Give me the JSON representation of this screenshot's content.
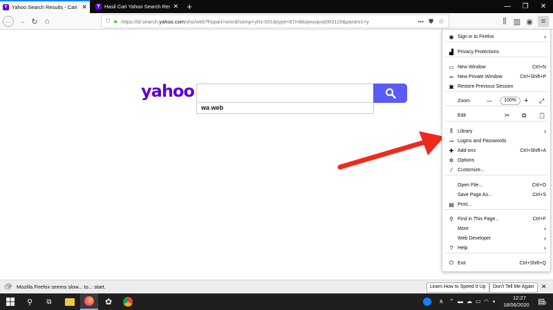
{
  "browser": {
    "tabs": [
      {
        "title": "Yahoo Search Results - Cari Wa",
        "favicon": "Y",
        "active": true
      },
      {
        "title": "Hasil Cari Yahoo Search Results",
        "favicon": "Y",
        "active": false
      }
    ],
    "new_tab": "+",
    "window_controls": {
      "minimize": "—",
      "maximize": "❐",
      "close": "✕"
    },
    "url": {
      "prefix": "https://id.search.",
      "domain": "yahoo.com",
      "suffix": "/yhs/web?hspart=omr&hsimp=yhs-001&type=87mbkqwuxpvp003119&param1=y"
    },
    "url_more": "•••"
  },
  "page": {
    "logo": "yahoo!",
    "search_value": "",
    "suggestion": "wa web"
  },
  "menu": {
    "items": [
      {
        "label": "Sign in to Firefox",
        "icon": "account-icon",
        "glyph": "◉",
        "shortcut": "",
        "chevron": true
      },
      {
        "label": "Privacy Protections",
        "icon": "chart-icon",
        "glyph": "▟",
        "shortcut": ""
      },
      {
        "label": "New Window",
        "icon": "window-icon",
        "glyph": "▭",
        "shortcut": "Ctrl+N"
      },
      {
        "label": "New Private Window",
        "icon": "mask-icon",
        "glyph": "∞",
        "shortcut": "Ctrl+Shift+P"
      },
      {
        "label": "Restore Previous Session",
        "icon": "restore-icon",
        "glyph": "▣",
        "shortcut": ""
      },
      {
        "label": "Library",
        "icon": "library-icon",
        "glyph": "⫼",
        "shortcut": "",
        "chevron": true
      },
      {
        "label": "Logins and Passwords",
        "icon": "key-icon",
        "glyph": "⊸",
        "shortcut": ""
      },
      {
        "label": "Add-ons",
        "icon": "puzzle-icon",
        "glyph": "✚",
        "shortcut": "Ctrl+Shift+A"
      },
      {
        "label": "Options",
        "icon": "gear-icon",
        "glyph": "✲",
        "shortcut": ""
      },
      {
        "label": "Customize...",
        "icon": "brush-icon",
        "glyph": "⁄",
        "shortcut": ""
      },
      {
        "label": "Open File...",
        "icon": "",
        "glyph": "",
        "shortcut": "Ctrl+O"
      },
      {
        "label": "Save Page As...",
        "icon": "",
        "glyph": "",
        "shortcut": "Ctrl+S"
      },
      {
        "label": "Print...",
        "icon": "printer-icon",
        "glyph": "▤",
        "shortcut": ""
      },
      {
        "label": "Find in This Page...",
        "icon": "search-icon",
        "glyph": "⚲",
        "shortcut": "Ctrl+F"
      },
      {
        "label": "More",
        "icon": "",
        "glyph": "",
        "shortcut": "",
        "chevron": true
      },
      {
        "label": "Web Developer",
        "icon": "",
        "glyph": "",
        "shortcut": "",
        "chevron": true
      },
      {
        "label": "Help",
        "icon": "help-icon",
        "glyph": "?",
        "shortcut": "",
        "chevron": true
      },
      {
        "label": "Exit",
        "icon": "power-icon",
        "glyph": "⏻",
        "shortcut": "Ctrl+Shift+Q"
      }
    ],
    "zoom": {
      "label": "Zoom",
      "minus": "—",
      "value": "100%",
      "plus": "+",
      "fullscreen": "⤢"
    },
    "edit": {
      "label": "Edit",
      "cut": "✂",
      "copy": "⧉",
      "paste": "📋"
    },
    "chevron": "›"
  },
  "notification": {
    "text": "Mozilla Firefox seems slow... to... start.",
    "learn_button": "Learn How to Speed It Up",
    "dismiss_button": "Don't Tell Me Again",
    "close": "✕"
  },
  "taskbar": {
    "time": "12:27",
    "date": "18/06/2020",
    "notif_count": "3"
  },
  "colors": {
    "yahoo_purple": "#6001d2",
    "search_button": "#5a5af5",
    "arrow": "#ee2a1e",
    "focus_blue": "#0a84ff"
  }
}
